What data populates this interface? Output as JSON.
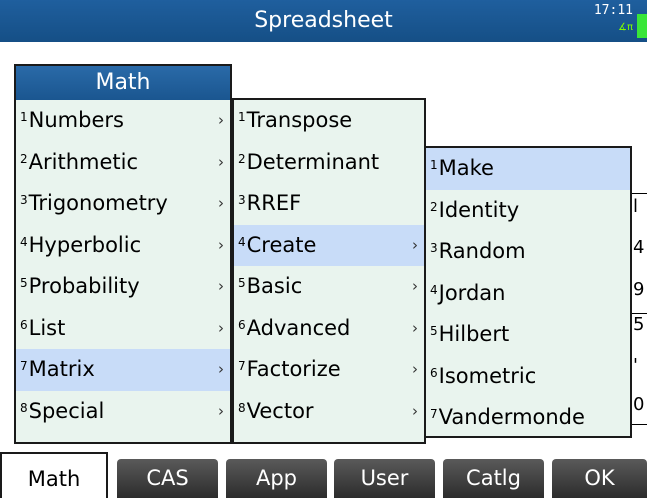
{
  "window": {
    "title": "Spreadsheet",
    "clock": "17:11",
    "angle_indicator": "∡π"
  },
  "menu_main": {
    "header": "Math",
    "items": [
      {
        "num": "1",
        "label": "Numbers",
        "arrow": "›"
      },
      {
        "num": "2",
        "label": "Arithmetic",
        "arrow": "›"
      },
      {
        "num": "3",
        "label": "Trigonometry",
        "arrow": "›"
      },
      {
        "num": "4",
        "label": "Hyperbolic",
        "arrow": "›"
      },
      {
        "num": "5",
        "label": "Probability",
        "arrow": "›"
      },
      {
        "num": "6",
        "label": "List",
        "arrow": "›"
      },
      {
        "num": "7",
        "label": "Matrix",
        "arrow": "›"
      },
      {
        "num": "8",
        "label": "Special",
        "arrow": "›"
      }
    ],
    "selected": "Matrix"
  },
  "menu_matrix": {
    "items": [
      {
        "num": "1",
        "label": "Transpose",
        "arrow": ""
      },
      {
        "num": "2",
        "label": "Determinant",
        "arrow": ""
      },
      {
        "num": "3",
        "label": "RREF",
        "arrow": ""
      },
      {
        "num": "4",
        "label": "Create",
        "arrow": "›"
      },
      {
        "num": "5",
        "label": "Basic",
        "arrow": "›"
      },
      {
        "num": "6",
        "label": "Advanced",
        "arrow": "›"
      },
      {
        "num": "7",
        "label": "Factorize",
        "arrow": "›"
      },
      {
        "num": "8",
        "label": "Vector",
        "arrow": "›"
      }
    ],
    "selected": "Create"
  },
  "menu_create": {
    "items": [
      {
        "num": "1",
        "label": "Make"
      },
      {
        "num": "2",
        "label": "Identity"
      },
      {
        "num": "3",
        "label": "Random"
      },
      {
        "num": "4",
        "label": "Jordan"
      },
      {
        "num": "5",
        "label": "Hilbert"
      },
      {
        "num": "6",
        "label": "Isometric"
      },
      {
        "num": "7",
        "label": "Vandermonde"
      }
    ],
    "selected": "Make"
  },
  "sheet_partial": [
    "l",
    "4",
    "9",
    "5",
    "'",
    "0"
  ],
  "softkeys": [
    {
      "label": "Math",
      "active": true
    },
    {
      "label": "CAS",
      "active": false
    },
    {
      "label": "App",
      "active": false
    },
    {
      "label": "User",
      "active": false
    },
    {
      "label": "Catlg",
      "active": false
    },
    {
      "label": "OK",
      "active": false
    }
  ],
  "colors": {
    "title_bar": "#1a5690",
    "menu_bg": "#e9f4ee",
    "selection": "#c8dcf8",
    "softkey": "#3a3a3a"
  }
}
